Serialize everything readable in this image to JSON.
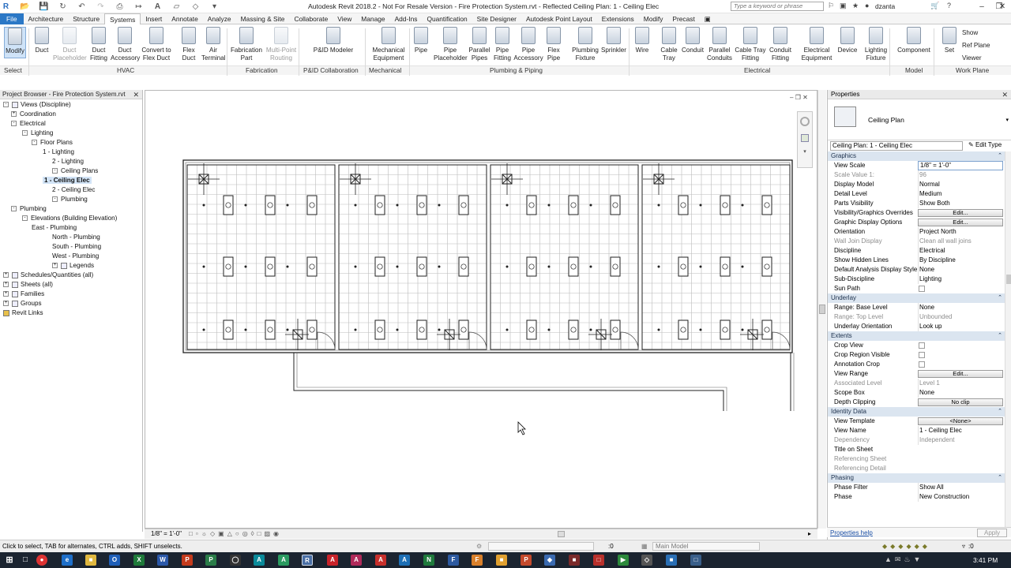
{
  "titlebar": {
    "title": "Autodesk Revit 2018.2 - Not For Resale Version -   Fire Protection System.rvt - Reflected Ceiling Plan: 1 - Ceiling Elec",
    "search_placeholder": "Type a keyword or phrase",
    "user": "dzanta"
  },
  "menu": [
    "File",
    "Architecture",
    "Structure",
    "Systems",
    "Insert",
    "Annotate",
    "Analyze",
    "Massing & Site",
    "Collaborate",
    "View",
    "Manage",
    "Add-Ins",
    "Quantification",
    "Site Designer",
    "Autodesk Point Layout",
    "Extensions",
    "Modify",
    "Precast"
  ],
  "ribbon": {
    "buttons": [
      {
        "l1": "Modify",
        "l2": "",
        "icon": "modify-cursor-icon"
      },
      {
        "l1": "Duct",
        "l2": "",
        "icon": "duct-icon"
      },
      {
        "l1": "Duct",
        "l2": "Placeholder",
        "icon": "duct-placeholder-icon"
      },
      {
        "l1": "Duct",
        "l2": "Fitting",
        "icon": "duct-fitting-icon"
      },
      {
        "l1": "Duct",
        "l2": "Accessory",
        "icon": "duct-accessory-icon"
      },
      {
        "l1": "Convert to",
        "l2": "Flex Duct",
        "icon": "convert-flex-duct-icon"
      },
      {
        "l1": "Flex",
        "l2": "Duct",
        "icon": "flex-duct-icon"
      },
      {
        "l1": "Air",
        "l2": "Terminal",
        "icon": "air-terminal-icon"
      },
      {
        "l1": "Fabrication",
        "l2": "Part",
        "icon": "fabrication-part-icon"
      },
      {
        "l1": "Multi-Point",
        "l2": "Routing",
        "icon": "multi-point-routing-icon"
      },
      {
        "l1": "P&ID Modeler",
        "l2": "",
        "icon": "pid-modeler-icon"
      },
      {
        "l1": "Mechanical",
        "l2": "Equipment",
        "icon": "mechanical-equipment-icon"
      },
      {
        "l1": "Pipe",
        "l2": "",
        "icon": "pipe-icon"
      },
      {
        "l1": "Pipe",
        "l2": "Placeholder",
        "icon": "pipe-placeholder-icon"
      },
      {
        "l1": "Parallel",
        "l2": "Pipes",
        "icon": "parallel-pipes-icon"
      },
      {
        "l1": "Pipe",
        "l2": "Fitting",
        "icon": "pipe-fitting-icon"
      },
      {
        "l1": "Pipe",
        "l2": "Accessory",
        "icon": "pipe-accessory-icon"
      },
      {
        "l1": "Flex",
        "l2": "Pipe",
        "icon": "flex-pipe-icon"
      },
      {
        "l1": "Plumbing",
        "l2": "Fixture",
        "icon": "plumbing-fixture-icon"
      },
      {
        "l1": "Sprinkler",
        "l2": "",
        "icon": "sprinkler-icon"
      },
      {
        "l1": "Wire",
        "l2": "",
        "icon": "wire-icon"
      },
      {
        "l1": "Cable",
        "l2": "Tray",
        "icon": "cable-tray-icon"
      },
      {
        "l1": "Conduit",
        "l2": "",
        "icon": "conduit-icon"
      },
      {
        "l1": "Parallel",
        "l2": "Conduits",
        "icon": "parallel-conduits-icon"
      },
      {
        "l1": "Cable Tray",
        "l2": "Fitting",
        "icon": "cable-tray-fitting-icon"
      },
      {
        "l1": "Conduit",
        "l2": "Fitting",
        "icon": "conduit-fitting-icon"
      },
      {
        "l1": "Electrical",
        "l2": "Equipment",
        "icon": "electrical-equipment-icon"
      },
      {
        "l1": "Device",
        "l2": "",
        "icon": "device-icon"
      },
      {
        "l1": "Lighting",
        "l2": "Fixture",
        "icon": "lighting-fixture-icon"
      },
      {
        "l1": "Component",
        "l2": "",
        "icon": "component-icon"
      },
      {
        "l1": "Set",
        "l2": "",
        "icon": "set-workplane-icon"
      }
    ],
    "small": [
      "Show",
      "Ref Plane",
      "Viewer"
    ],
    "panels": [
      "Select",
      "HVAC",
      "Fabrication",
      "P&ID Collaboration",
      "Mechanical",
      "Plumbing & Piping",
      "Electrical",
      "Model",
      "Work Plane"
    ]
  },
  "browser": {
    "title": "Project Browser - Fire Protection System.rvt",
    "items": [
      {
        "label": "Views (Discipline)",
        "toggle": "-"
      },
      {
        "label": "Coordination",
        "toggle": "+"
      },
      {
        "label": "Electrical",
        "toggle": "-"
      },
      {
        "label": "Lighting",
        "toggle": "-"
      },
      {
        "label": "Floor Plans",
        "toggle": "-"
      },
      {
        "label": "1 - Lighting",
        "toggle": ""
      },
      {
        "label": "2 - Lighting",
        "toggle": ""
      },
      {
        "label": "Ceiling Plans",
        "toggle": "-"
      },
      {
        "label": "1 - Ceiling Elec",
        "toggle": ""
      },
      {
        "label": "2 - Ceiling Elec",
        "toggle": ""
      },
      {
        "label": "Plumbing",
        "toggle": "-"
      },
      {
        "label": "Plumbing",
        "toggle": "-"
      },
      {
        "label": "Elevations (Building Elevation)",
        "toggle": "-"
      },
      {
        "label": "East - Plumbing",
        "toggle": ""
      },
      {
        "label": "North - Plumbing",
        "toggle": ""
      },
      {
        "label": "South - Plumbing",
        "toggle": ""
      },
      {
        "label": "West - Plumbing",
        "toggle": ""
      },
      {
        "label": "Legends",
        "toggle": "+"
      },
      {
        "label": "Schedules/Quantities (all)",
        "toggle": "+"
      },
      {
        "label": "Sheets (all)",
        "toggle": "+"
      },
      {
        "label": "Families",
        "toggle": "+"
      },
      {
        "label": "Groups",
        "toggle": "+"
      },
      {
        "label": "Revit Links",
        "toggle": ""
      }
    ]
  },
  "view": {
    "scale_label": "1/8\" = 1'-0\""
  },
  "properties": {
    "title": "Properties",
    "type_name": "Ceiling Plan",
    "instance": "Ceiling Plan: 1 - Ceiling Elec",
    "edit_type": "Edit Type",
    "rows": [
      {
        "k": "Graphics",
        "v": "",
        "kind": "group"
      },
      {
        "k": "View Scale",
        "v": "1/8\" = 1'-0\"",
        "kind": "input"
      },
      {
        "k": "Scale Value    1:",
        "v": "96",
        "kind": "dis"
      },
      {
        "k": "Display Model",
        "v": "Normal",
        "kind": "val"
      },
      {
        "k": "Detail Level",
        "v": "Medium",
        "kind": "val"
      },
      {
        "k": "Parts Visibility",
        "v": "Show Both",
        "kind": "val"
      },
      {
        "k": "Visibility/Graphics Overrides",
        "v": "Edit...",
        "kind": "btn"
      },
      {
        "k": "Graphic Display Options",
        "v": "Edit...",
        "kind": "btn"
      },
      {
        "k": "Orientation",
        "v": "Project North",
        "kind": "val"
      },
      {
        "k": "Wall Join Display",
        "v": "Clean all wall joins",
        "kind": "dis"
      },
      {
        "k": "Discipline",
        "v": "Electrical",
        "kind": "val"
      },
      {
        "k": "Show Hidden Lines",
        "v": "By Discipline",
        "kind": "val"
      },
      {
        "k": "Default Analysis Display Style",
        "v": "None",
        "kind": "val"
      },
      {
        "k": "Sub-Discipline",
        "v": "Lighting",
        "kind": "val"
      },
      {
        "k": "Sun Path",
        "v": "",
        "kind": "chk"
      },
      {
        "k": "Underlay",
        "v": "",
        "kind": "group"
      },
      {
        "k": "Range: Base Level",
        "v": "None",
        "kind": "val"
      },
      {
        "k": "Range: Top Level",
        "v": "Unbounded",
        "kind": "dis"
      },
      {
        "k": "Underlay Orientation",
        "v": "Look up",
        "kind": "val"
      },
      {
        "k": "Extents",
        "v": "",
        "kind": "group"
      },
      {
        "k": "Crop View",
        "v": "",
        "kind": "chk"
      },
      {
        "k": "Crop Region Visible",
        "v": "",
        "kind": "chk"
      },
      {
        "k": "Annotation Crop",
        "v": "",
        "kind": "chk"
      },
      {
        "k": "View Range",
        "v": "Edit...",
        "kind": "btn"
      },
      {
        "k": "Associated Level",
        "v": "Level 1",
        "kind": "dis"
      },
      {
        "k": "Scope Box",
        "v": "None",
        "kind": "val"
      },
      {
        "k": "Depth Clipping",
        "v": "No clip",
        "kind": "btn"
      },
      {
        "k": "Identity Data",
        "v": "",
        "kind": "group"
      },
      {
        "k": "View Template",
        "v": "<None>",
        "kind": "btn"
      },
      {
        "k": "View Name",
        "v": "1 - Ceiling Elec",
        "kind": "val"
      },
      {
        "k": "Dependency",
        "v": "Independent",
        "kind": "dis"
      },
      {
        "k": "Title on Sheet",
        "v": "",
        "kind": "val"
      },
      {
        "k": "Referencing Sheet",
        "v": "",
        "kind": "dis"
      },
      {
        "k": "Referencing Detail",
        "v": "",
        "kind": "dis"
      },
      {
        "k": "Phasing",
        "v": "",
        "kind": "group"
      },
      {
        "k": "Phase Filter",
        "v": "Show All",
        "kind": "val"
      },
      {
        "k": "Phase",
        "v": "New Construction",
        "kind": "val"
      }
    ],
    "help": "Properties help",
    "apply": "Apply"
  },
  "status": {
    "hint": "Click to select, TAB for alternates, CTRL adds, SHIFT unselects.",
    "coord": ":0",
    "model": "Main Model",
    "right": ":0"
  },
  "clock": "3:41 PM"
}
